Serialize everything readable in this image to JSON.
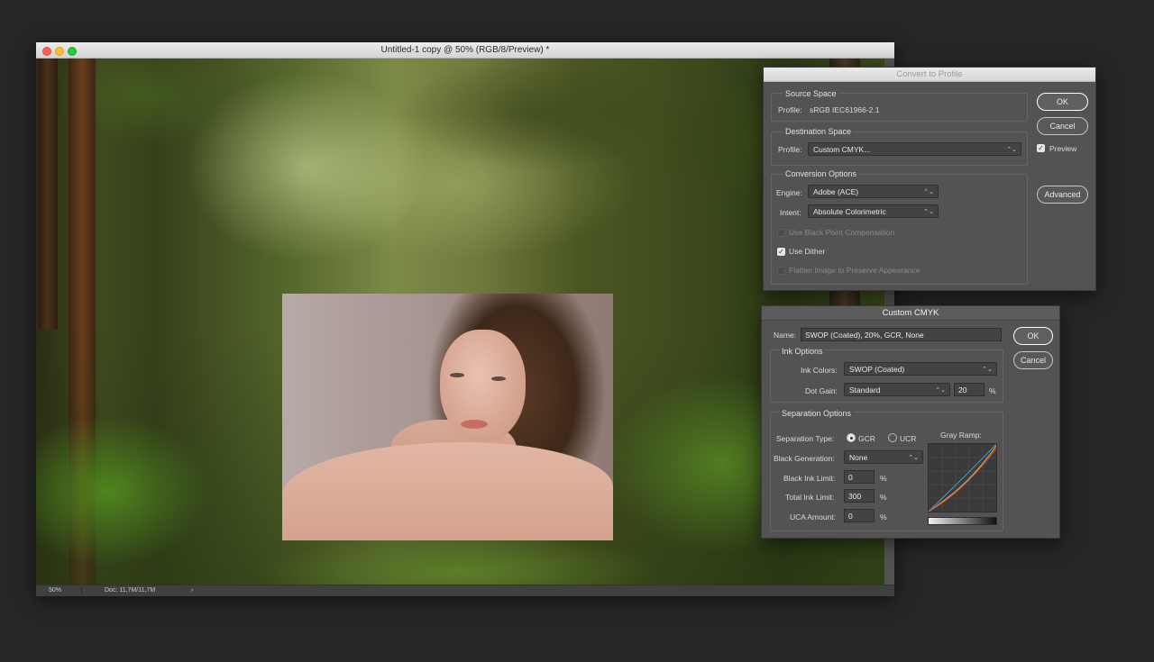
{
  "document": {
    "title": "Untitled-1 copy @ 50% (RGB/8/Preview) *",
    "zoom": "50%",
    "doc_size": "Doc: 11,7M/11,7M",
    "status_arrow": "›"
  },
  "convert_profile": {
    "title": "Convert to Profile",
    "source_space": {
      "label": "Source Space",
      "profile_label": "Profile:",
      "profile_value": "sRGB IEC61966-2.1"
    },
    "destination_space": {
      "label": "Destination Space",
      "profile_label": "Profile:",
      "profile_value": "Custom CMYK..."
    },
    "conversion_options": {
      "label": "Conversion Options",
      "engine_label": "Engine:",
      "engine_value": "Adobe (ACE)",
      "intent_label": "Intent:",
      "intent_value": "Absolute Colorimetric",
      "black_point_label": "Use Black Point Compensation",
      "black_point_checked": false,
      "dither_label": "Use Dither",
      "dither_checked": true,
      "flatten_label": "Flatten Image to Preserve Appearance",
      "flatten_checked": false
    },
    "buttons": {
      "ok": "OK",
      "cancel": "Cancel",
      "advanced": "Advanced"
    },
    "preview_label": "Preview",
    "preview_checked": true
  },
  "custom_cmyk": {
    "title": "Custom CMYK",
    "name_label": "Name:",
    "name_value": "SWOP (Coated), 20%, GCR, None",
    "ink_options": {
      "label": "Ink Options",
      "ink_colors_label": "Ink Colors:",
      "ink_colors_value": "SWOP (Coated)",
      "dot_gain_label": "Dot Gain:",
      "dot_gain_value": "Standard",
      "dot_gain_amount": "20",
      "percent": "%"
    },
    "separation_options": {
      "label": "Separation Options",
      "separation_type_label": "Separation Type:",
      "gcr_label": "GCR",
      "ucr_label": "UCR",
      "selected": "GCR",
      "black_generation_label": "Black Generation:",
      "black_generation_value": "None",
      "black_ink_limit_label": "Black Ink Limit:",
      "black_ink_limit_value": "0",
      "total_ink_limit_label": "Total Ink Limit:",
      "total_ink_limit_value": "300",
      "uca_amount_label": "UCA Amount:",
      "uca_amount_value": "0",
      "percent": "%",
      "gray_ramp_label": "Gray Ramp:"
    },
    "buttons": {
      "ok": "OK",
      "cancel": "Cancel"
    }
  },
  "colors": {
    "dialog_bg": "#535353",
    "field_bg": "#434343",
    "ramp_cyan": "#3f9fd0",
    "ramp_magenta": "#d9504f",
    "ramp_yellow": "#d2b73c",
    "ramp_black": "#222222"
  },
  "icons": {
    "close": "close-dot-icon",
    "minimize": "minimize-dot-icon",
    "maximize": "maximize-dot-icon",
    "chevron": "chevron-updown-icon",
    "check": "checkmark-icon"
  }
}
